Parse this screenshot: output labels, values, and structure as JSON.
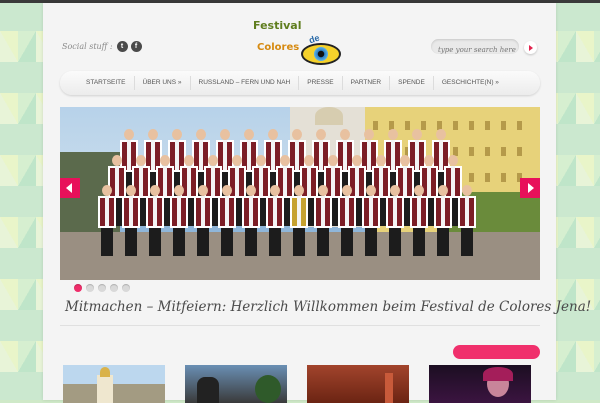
{
  "header": {
    "social_label": "Social stuff :",
    "social_icons": [
      "twitter-icon",
      "facebook-icon"
    ],
    "logo_text": {
      "line1": "Festival",
      "line2": "Colores",
      "line3": "de"
    },
    "search_placeholder": "type your search here"
  },
  "nav": {
    "items": [
      "STARTSEITE",
      "ÜBER UNS »",
      "RUSSLAND – FERN UND NAH",
      "PRESSE",
      "PARTNER",
      "SPENDE",
      "GESCHICHTE(N) »"
    ]
  },
  "slider": {
    "dots_count": 5,
    "active_dot": 1
  },
  "tagline": "Mitmachen – Mitfeiern: Herzlich Willkommen beim Festival de Colores Jena!",
  "colors": {
    "accent": "#e8105a",
    "tagline": "#4a4a4a",
    "logo_green": "#5f7d1e",
    "logo_orange": "#d68a11"
  }
}
